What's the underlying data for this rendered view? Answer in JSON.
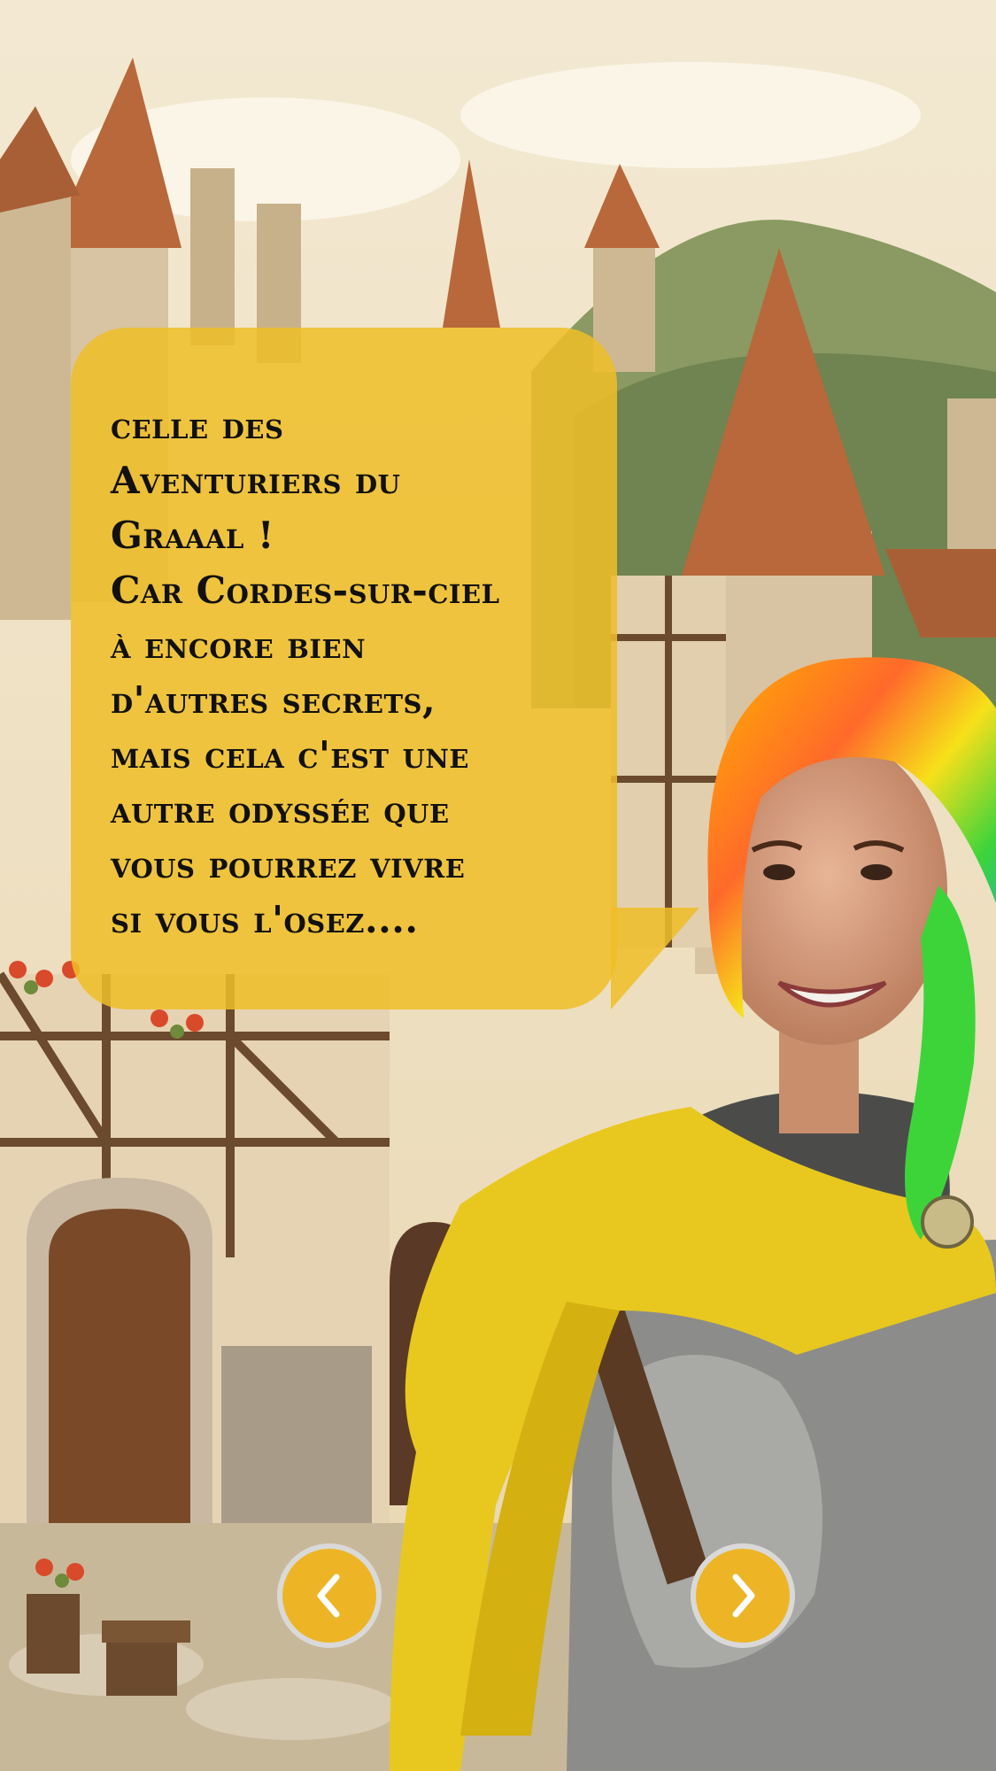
{
  "story": {
    "text": "celle des\nAventuriers du\nGraaal !\nCar Cordes-sur-ciel\nà encore bien\nd'autres secrets,\nmais cela c'est une\nautre odyssée que\nvous pourrez vivre\nsi vous l'osez...."
  },
  "navigation": {
    "prev_icon": "chevron-left-icon",
    "next_icon": "chevron-right-icon",
    "button_color": "#edb525",
    "ring_color": "#d9d9d9"
  },
  "colors": {
    "bubble": "#efbe28",
    "sky": "#efe3c8",
    "roof": "#b8683a",
    "scarf": "#e8c81e"
  }
}
